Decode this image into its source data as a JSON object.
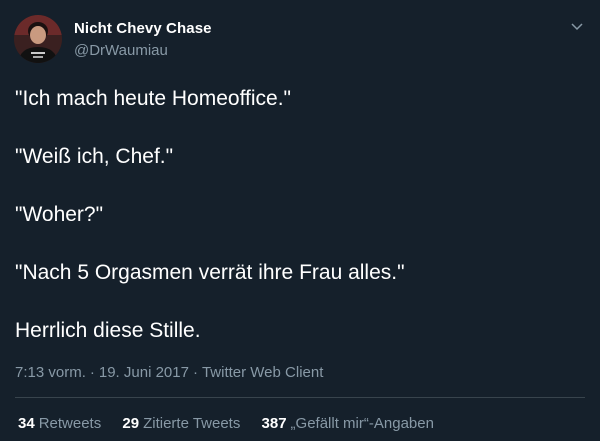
{
  "user": {
    "display_name": "Nicht Chevy Chase",
    "handle": "@DrWaumiau"
  },
  "tweet": {
    "lines": [
      "\"Ich mach heute Homeoffice.\"",
      "\"Weiß ich, Chef.\"",
      "\"Woher?\"",
      "\"Nach 5 Orgasmen verrät ihre Frau alles.\"",
      "Herrlich diese Stille."
    ]
  },
  "meta": {
    "time": "7:13 vorm.",
    "separator": "·",
    "date": "19. Juni 2017",
    "client": "Twitter Web Client"
  },
  "stats": {
    "retweets": {
      "count": "34",
      "label": "Retweets"
    },
    "quotes": {
      "count": "29",
      "label": "Zitierte Tweets"
    },
    "likes": {
      "count": "387",
      "label": "„Gefällt mir“-Angaben"
    }
  },
  "icons": {
    "avatar": "avatar-photo",
    "menu": "chevron-down-icon"
  },
  "colors": {
    "background": "#15202b",
    "primary_text": "#ffffff",
    "secondary_text": "#8899a6",
    "divider": "#38444d"
  }
}
